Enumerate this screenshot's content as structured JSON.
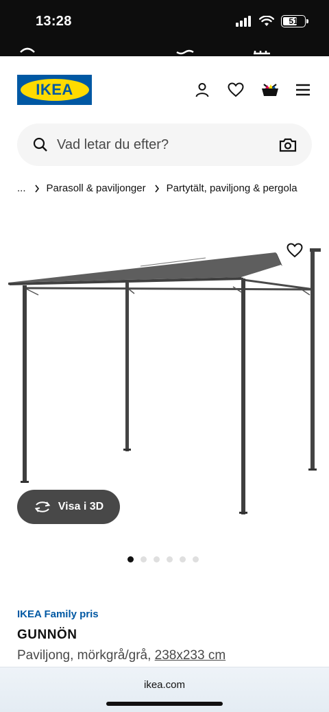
{
  "status": {
    "time": "13:28",
    "battery": "51"
  },
  "search": {
    "placeholder": "Vad letar du efter?"
  },
  "breadcrumb": {
    "ellipsis": "...",
    "items": [
      "Parasoll & paviljonger",
      "Partytält, paviljong & pergola"
    ]
  },
  "logo": {
    "text": "IKEA"
  },
  "gallery": {
    "view3d_label": "Visa i 3D",
    "image_count": 6,
    "active_index": 0
  },
  "product": {
    "family_price": "IKEA Family pris",
    "name": "GUNNÖN",
    "description": "Paviljong, mörkgrå/grå, ",
    "size": "238x233 cm"
  },
  "browser": {
    "url": "ikea.com"
  },
  "colors": {
    "ikea_blue": "#0058a3",
    "ikea_yellow": "#ffdb00",
    "dark": "#111111"
  }
}
